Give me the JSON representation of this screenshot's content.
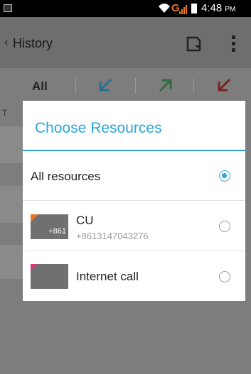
{
  "status_bar": {
    "network": "G",
    "time": "4:48",
    "ampm": "PM",
    "icons": [
      "gallery-notification-icon",
      "wifi-icon",
      "signal-icon",
      "battery-icon"
    ]
  },
  "action_bar": {
    "title": "History",
    "icons": [
      "back-chevron-icon",
      "save-icon",
      "overflow-menu-icon"
    ]
  },
  "tabs": {
    "all_label": "All",
    "icons": [
      "incoming-call-icon",
      "outgoing-call-icon",
      "missed-call-icon"
    ],
    "colors": {
      "incoming": "#2aa6dc",
      "outgoing": "#3fbf5f",
      "missed": "#d63030"
    }
  },
  "background": {
    "section_letter": "T"
  },
  "dialog": {
    "title": "Choose Resources",
    "accent_color": "#2aa6dc",
    "options": [
      {
        "label": "All resources",
        "selected": true
      },
      {
        "name": "CU",
        "number": "+8613147043276",
        "sim_label": "+861",
        "sim_color": "#e87722",
        "selected": false
      },
      {
        "name": "Internet call",
        "sim_color": "#e0307a",
        "selected": false
      }
    ]
  }
}
